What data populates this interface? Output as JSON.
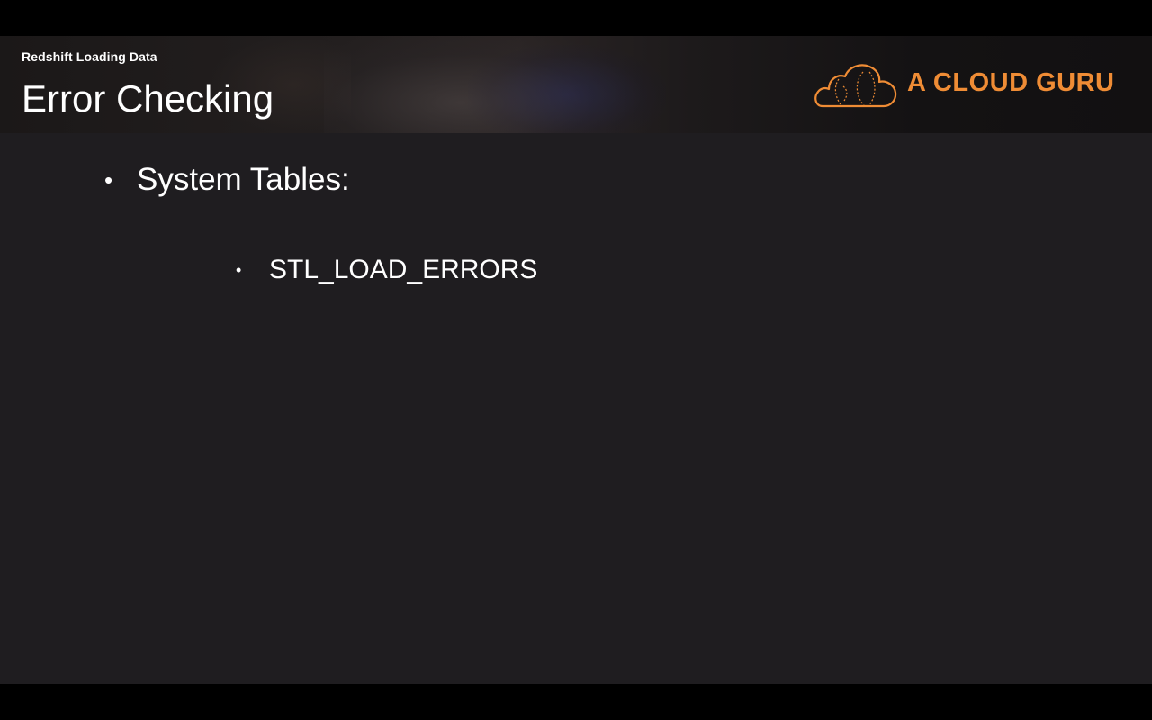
{
  "header": {
    "subtitle": "Redshift Loading Data",
    "title": "Error Checking",
    "logo_text": "A CLOUD GURU",
    "logo_icon": "cloud-icon",
    "brand_color": "#ef8c35"
  },
  "content": {
    "bullets": [
      {
        "marker": "•",
        "text": "System Tables:"
      },
      {
        "marker": "•",
        "text": "STL_LOAD_ERRORS"
      }
    ]
  }
}
